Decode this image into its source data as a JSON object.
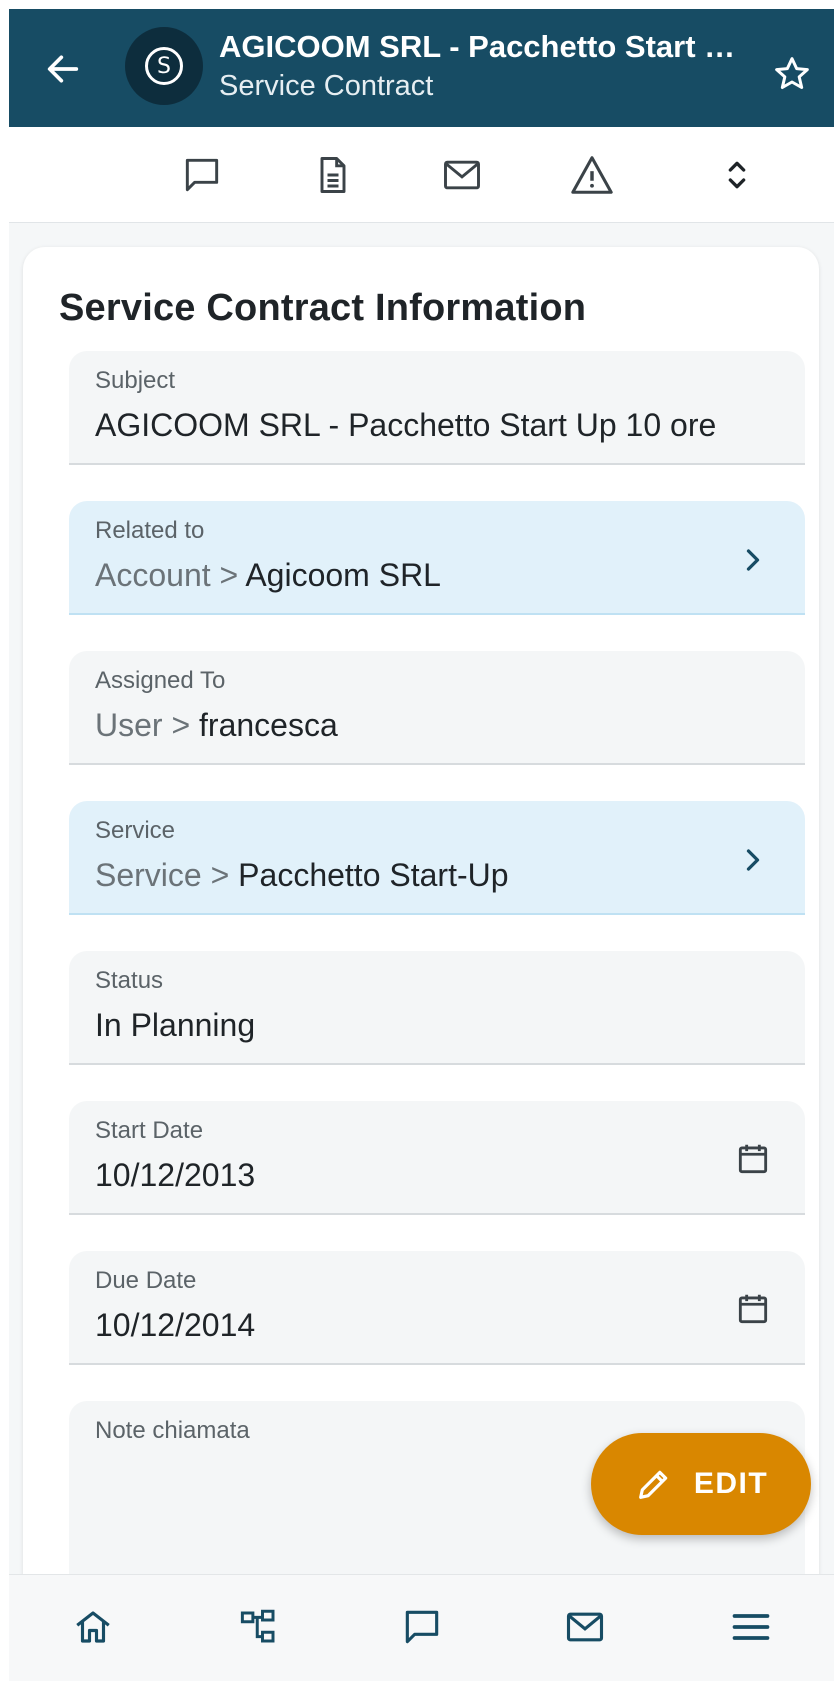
{
  "header": {
    "title": "AGICOOM SRL - Pacchetto Start Up...",
    "subtitle": "Service Contract",
    "avatar_letter": "S",
    "colors": {
      "bar": "#174c64",
      "avatar": "#0d2d3d"
    },
    "icons": {
      "back": "arrow-left-icon",
      "favorite": "star-outline-icon"
    }
  },
  "toolbar": {
    "icons": [
      "comment-icon",
      "document-icon",
      "mail-icon",
      "warning-icon",
      "expand-collapse-icon"
    ]
  },
  "card": {
    "title": "Service Contract Information",
    "fields": [
      {
        "label": "Subject",
        "value": "AGICOOM SRL - Pacchetto Start Up 10 ore"
      },
      {
        "label": "Related to",
        "prefix": "Account > ",
        "value": "Agicoom SRL",
        "link": true
      },
      {
        "label": "Assigned To",
        "prefix": "User > ",
        "value": "francesca"
      },
      {
        "label": "Service",
        "prefix": "Service > ",
        "value": "Pacchetto Start-Up",
        "link": true
      },
      {
        "label": "Status",
        "value": "In Planning"
      },
      {
        "label": "Start Date",
        "value": "10/12/2013",
        "icon": "calendar-icon"
      },
      {
        "label": "Due Date",
        "value": "10/12/2014",
        "icon": "calendar-icon"
      },
      {
        "label": "Note chiamata",
        "value": ""
      }
    ]
  },
  "fab": {
    "label": "EDIT",
    "icon": "pencil-icon",
    "color": "#d98700"
  },
  "bottom_nav": {
    "icons": [
      "home-icon",
      "hierarchy-icon",
      "comment-icon",
      "mail-icon",
      "menu-icon"
    ],
    "accent": "#174c64"
  }
}
